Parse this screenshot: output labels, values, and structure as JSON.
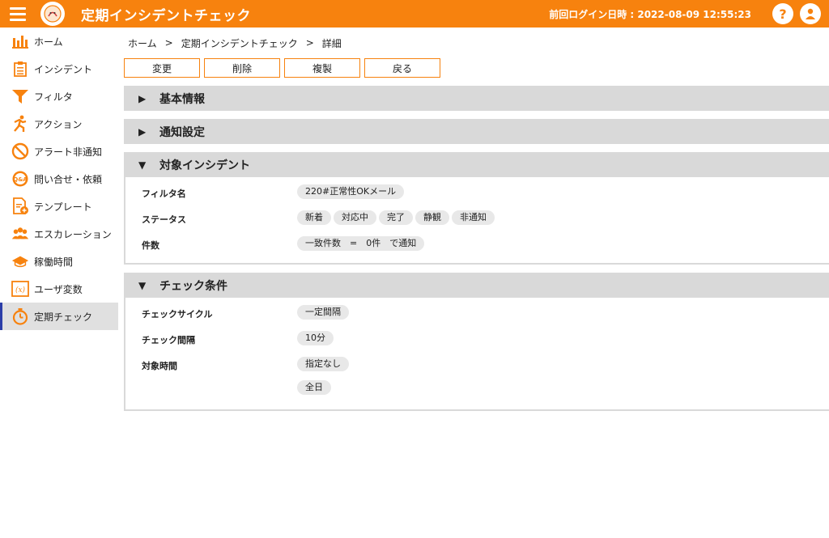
{
  "header": {
    "app_title": "定期インシデントチェック",
    "last_login": "前回ログイン日時 : 2022-08-09 12:55:23",
    "help_glyph": "?",
    "accent": "#f7820e"
  },
  "sidebar": {
    "items": [
      {
        "label": "ホーム",
        "icon": "bar-chart-icon"
      },
      {
        "label": "インシデント",
        "icon": "clipboard-icon"
      },
      {
        "label": "フィルタ",
        "icon": "funnel-icon"
      },
      {
        "label": "アクション",
        "icon": "running-person-icon"
      },
      {
        "label": "アラート非通知",
        "icon": "prohibited-icon"
      },
      {
        "label": "問い合せ・依頼",
        "icon": "qa-icon"
      },
      {
        "label": "テンプレート",
        "icon": "template-add-icon"
      },
      {
        "label": "エスカレーション",
        "icon": "group-icon"
      },
      {
        "label": "稼働時間",
        "icon": "hat-icon"
      },
      {
        "label": "ユーザ変数",
        "icon": "variable-icon"
      },
      {
        "label": "定期チェック",
        "icon": "timer-icon",
        "active": true
      }
    ]
  },
  "breadcrumb": {
    "home": "ホーム",
    "parent": "定期インシデントチェック",
    "current": "詳細",
    "sep": ">"
  },
  "toolbar": {
    "edit": "変更",
    "delete": "削除",
    "copy": "複製",
    "back": "戻る"
  },
  "sections": {
    "basic": {
      "title": "基本情報",
      "collapsed_marker": "▶"
    },
    "notify": {
      "title": "通知設定",
      "collapsed_marker": "▶"
    },
    "target": {
      "title": "対象インシデント",
      "expanded_marker": "▼",
      "filter_label": "フィルタ名",
      "filter_value": "220#正常性OKメール",
      "status_label": "ステータス",
      "statuses": [
        "新着",
        "対応中",
        "完了",
        "静観",
        "非通知"
      ],
      "count_label": "件数",
      "count_value": "一致件数　=　0件　で通知"
    },
    "check": {
      "title": "チェック条件",
      "expanded_marker": "▼",
      "cycle_label": "チェックサイクル",
      "cycle_value": "一定間隔",
      "interval_label": "チェック間隔",
      "interval_value": "10分",
      "time_label": "対象時間",
      "time_value": "指定なし",
      "time_value2": "全日"
    }
  }
}
